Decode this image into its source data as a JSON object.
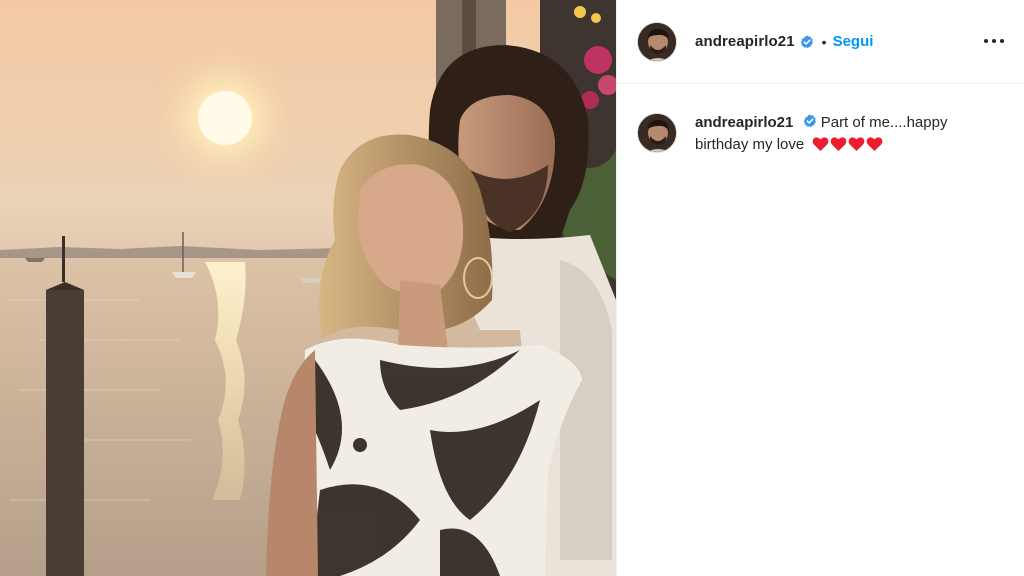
{
  "post": {
    "username": "andreapirlo21",
    "separator": "•",
    "follow_label": "Segui",
    "more_icon": "more-horizontal-icon",
    "caption_text": "Part of me....happy birthday my love",
    "caption_emoji": [
      "red-heart",
      "red-heart",
      "red-heart",
      "red-heart"
    ],
    "verified_color": "#3897f0",
    "follow_color": "#0095f6",
    "heart_color": "#ed1c2e"
  },
  "photo": {
    "description_icon": "post-photo"
  }
}
